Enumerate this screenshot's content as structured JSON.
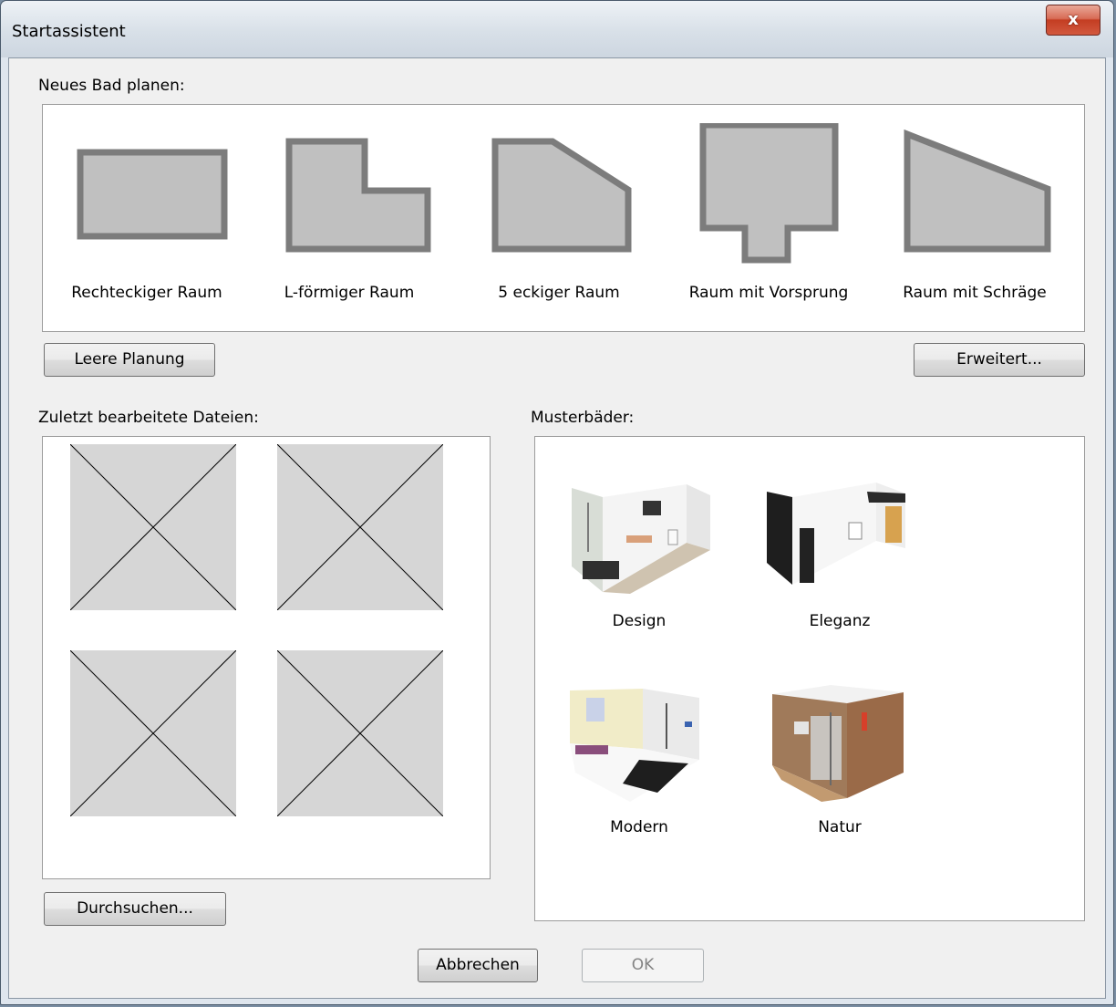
{
  "window": {
    "title": "Startassistent",
    "close_label": "x"
  },
  "new_bath": {
    "heading": "Neues Bad planen:",
    "rooms": [
      {
        "label": "Rechteckiger Raum",
        "icon": "rectangle-room-icon"
      },
      {
        "label": "L-förmiger Raum",
        "icon": "l-shaped-room-icon"
      },
      {
        "label": "5 eckiger Raum",
        "icon": "pentagon-room-icon"
      },
      {
        "label": "Raum mit Vorsprung",
        "icon": "room-with-projection-icon"
      },
      {
        "label": "Raum mit Schräge",
        "icon": "room-with-slope-icon"
      }
    ],
    "empty_button": "Leere Planung",
    "advanced_button": "Erweitert..."
  },
  "recent": {
    "heading": "Zuletzt bearbeitete Dateien:",
    "browse_button": "Durchsuchen...",
    "thumbnail_count": 4
  },
  "samples": {
    "heading": "Musterbäder:",
    "items": [
      {
        "label": "Design"
      },
      {
        "label": "Eleganz"
      },
      {
        "label": "Modern"
      },
      {
        "label": "Natur"
      }
    ]
  },
  "footer": {
    "cancel_button": "Abbrechen",
    "ok_button": "OK"
  },
  "colors": {
    "shape_fill": "#c0c0c0",
    "shape_border": "#7c7c7c",
    "placeholder": "#d6d6d6"
  }
}
